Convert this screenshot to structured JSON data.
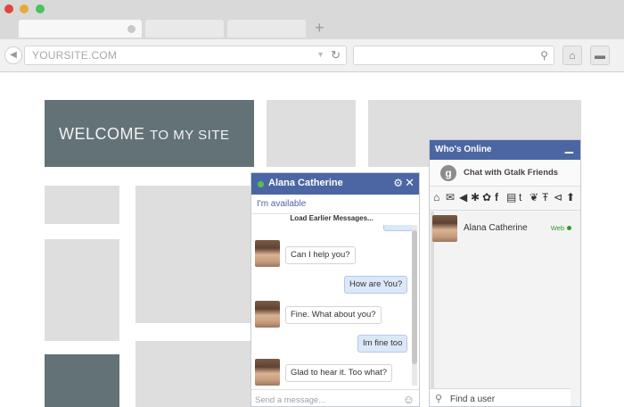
{
  "browser": {
    "url": "YOURSITE.COM",
    "new_tab": "+",
    "traffic_colors": [
      "#e0463a",
      "#e6a93a",
      "#4cc15e"
    ]
  },
  "site": {
    "welcome_parts": [
      "WELCOME",
      "TO MY SITE"
    ]
  },
  "chat": {
    "name": "Alana Catherine",
    "status": "I'm available",
    "load_earlier": "Load Earlier Messages...",
    "composer_placeholder": "Send a message...",
    "messages": [
      {
        "from": "them",
        "text": "Can I help you?"
      },
      {
        "from": "me",
        "text": "How are You?"
      },
      {
        "from": "them",
        "text": "Fine. What about you?"
      },
      {
        "from": "me",
        "text": "Im fine too"
      },
      {
        "from": "them",
        "text": "Glad to hear it. Too what?"
      }
    ],
    "header_color": "#4c66a4"
  },
  "who_online": {
    "title": "Who's Online",
    "gtalk_label": "Chat with Gtalk Friends",
    "contacts": [
      {
        "name": "Alana Catherine",
        "status": "Web"
      }
    ],
    "find_placeholder": "Find a user"
  }
}
